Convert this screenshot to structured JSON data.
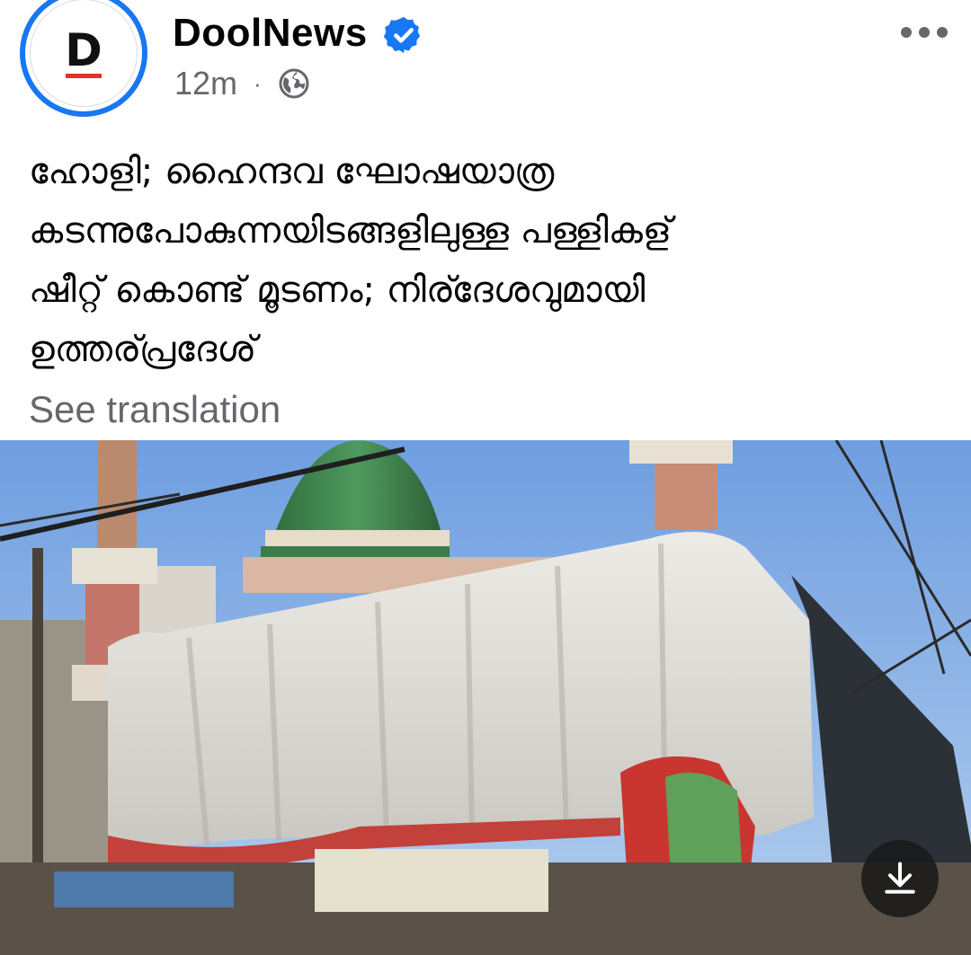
{
  "post": {
    "page_name": "DoolNews",
    "logo_letter": "D",
    "timestamp": "12m",
    "separator": "·",
    "audience_icon": "globe-icon",
    "verified_icon": "verified-badge-icon",
    "more_icon": "more-options-icon",
    "text": "ഹോളി; ഹൈന്ദവ ഘോഷയാത്ര\nകടന്നുപോകുന്നയിടങ്ങളിലുള്ള പള്ളികള്\nഷീറ്റ് കൊണ്ട് മൂടണം; നിര്ദേശവുമായി\nഉത്തര്പ്രദേശ്",
    "see_translation": "See translation",
    "download_icon": "download-icon"
  },
  "colors": {
    "verified_blue": "#1877f2",
    "logo_red": "#e0312a",
    "secondary_text": "#65676b"
  }
}
